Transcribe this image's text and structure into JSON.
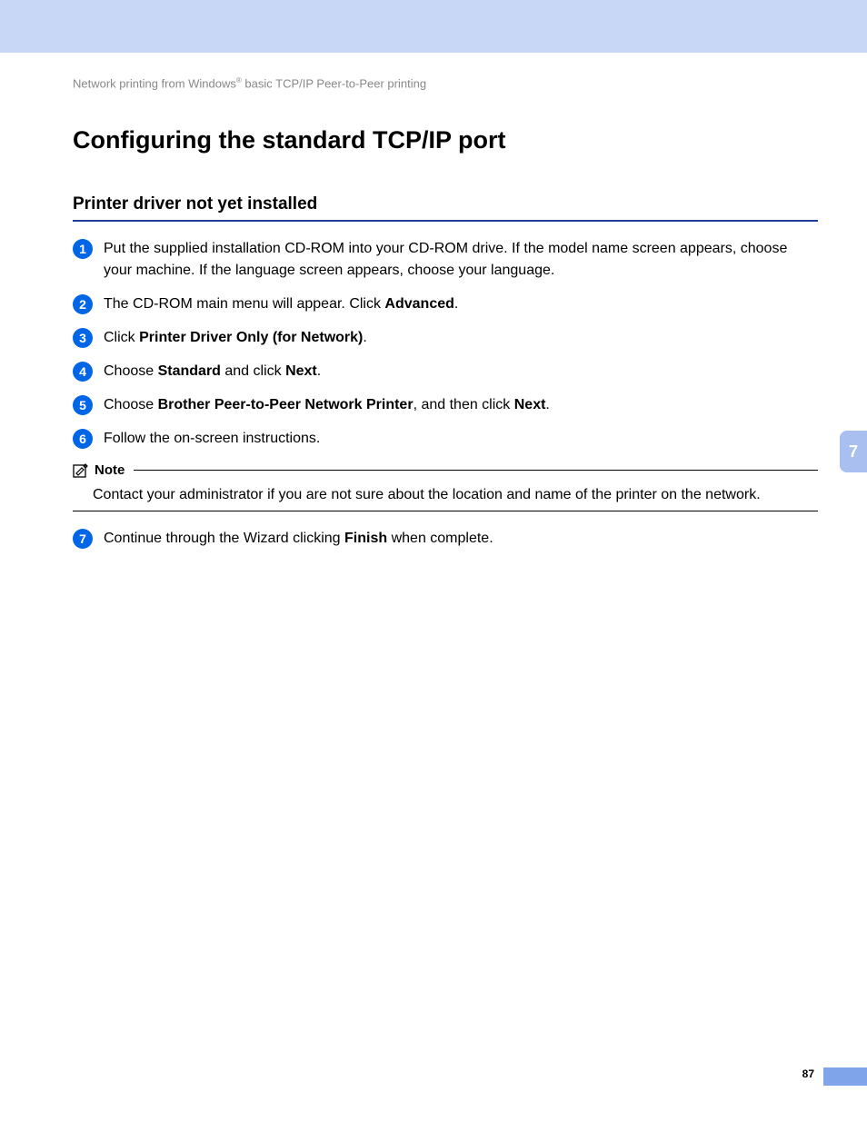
{
  "breadcrumb": {
    "pre": "Network printing from Windows",
    "sup": "®",
    "post": " basic TCP/IP Peer-to-Peer printing"
  },
  "h1": "Configuring the standard TCP/IP port",
  "h2": "Printer driver not yet installed",
  "steps": {
    "s1": "Put the supplied installation CD-ROM into your CD-ROM drive. If the model name screen appears, choose your machine. If the language screen appears, choose your language.",
    "s2": {
      "pre": "The CD-ROM main menu will appear. Click ",
      "b": "Advanced",
      "post": "."
    },
    "s3": {
      "pre": "Click ",
      "b": "Printer Driver Only (for Network)",
      "post": "."
    },
    "s4": {
      "pre": "Choose ",
      "b1": "Standard",
      "mid": " and click ",
      "b2": "Next",
      "post": "."
    },
    "s5": {
      "pre": "Choose ",
      "b1": "Brother Peer-to-Peer Network Printer",
      "mid": ", and then click ",
      "b2": "Next",
      "post": "."
    },
    "s6": "Follow the on-screen instructions.",
    "s7": {
      "pre": "Continue through the Wizard clicking ",
      "b": "Finish",
      "post": " when complete."
    }
  },
  "badges": {
    "n1": "1",
    "n2": "2",
    "n3": "3",
    "n4": "4",
    "n5": "5",
    "n6": "6",
    "n7": "7"
  },
  "note": {
    "label": "Note",
    "text": "Contact your administrator if you are not sure about the location and name of the printer on the network."
  },
  "sideTab": "7",
  "pageNumber": "87"
}
